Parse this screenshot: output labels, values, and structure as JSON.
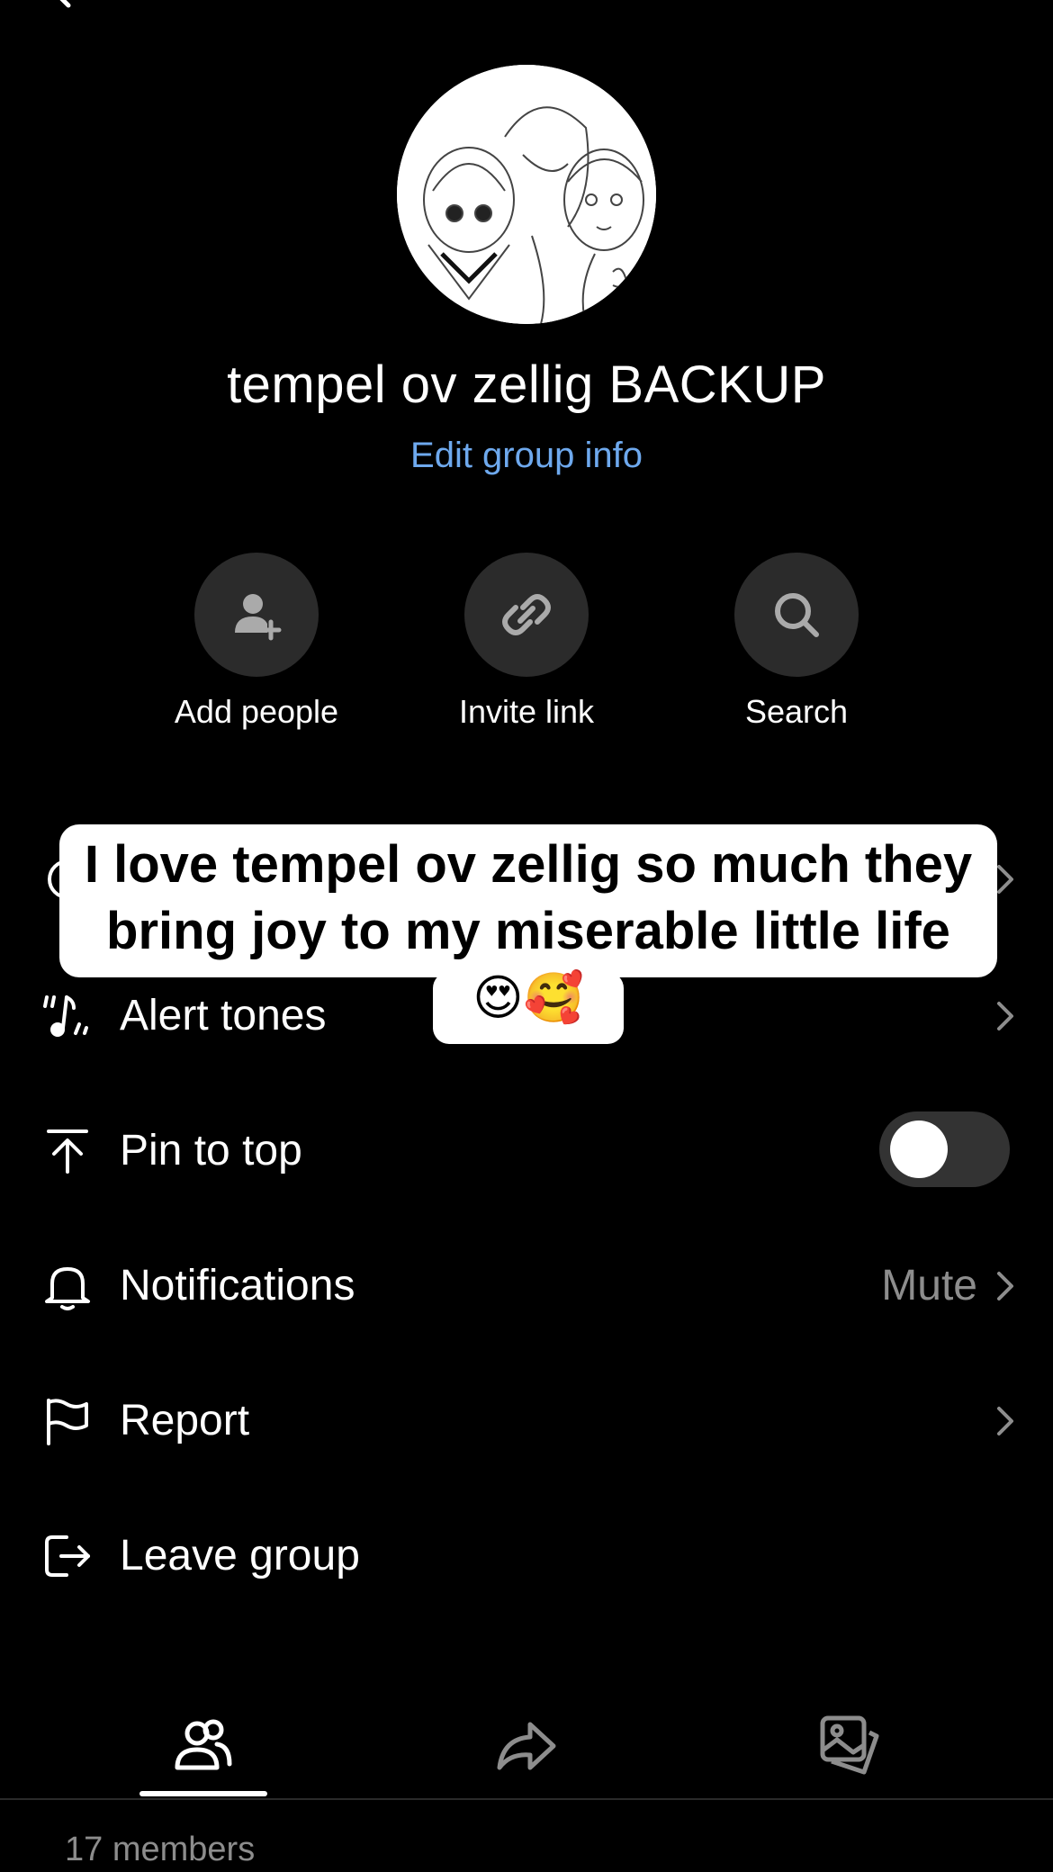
{
  "group": {
    "name": "tempel ov zellig BACKUP",
    "edit_label": "Edit group info"
  },
  "actions": [
    {
      "label": "Add people",
      "icon": "add-person-icon"
    },
    {
      "label": "Invite link",
      "icon": "link-icon"
    },
    {
      "label": "Search",
      "icon": "search-icon"
    }
  ],
  "settings": {
    "alert_tones": {
      "label": "Alert tones",
      "icon": "music-note-icon"
    },
    "pin_to_top": {
      "label": "Pin to top",
      "icon": "pin-top-icon",
      "enabled": false
    },
    "notifications": {
      "label": "Notifications",
      "value": "Mute",
      "icon": "bell-icon"
    },
    "report": {
      "label": "Report",
      "icon": "flag-icon"
    },
    "leave_group": {
      "label": "Leave group",
      "icon": "leave-icon"
    }
  },
  "caption": {
    "line1": "I love tempel ov zellig so much they",
    "line2": "bring joy to my miserable little life",
    "emoji": "😍🥰"
  },
  "tabs": [
    {
      "icon": "members-icon",
      "active": true
    },
    {
      "icon": "share-icon",
      "active": false
    },
    {
      "icon": "media-icon",
      "active": false
    }
  ],
  "members": {
    "count_label": "17 members"
  },
  "colors": {
    "background": "#000000",
    "accent_link": "#6ea9ee",
    "circle_button": "#2b2b2b",
    "secondary_text": "#8d8d8d"
  }
}
